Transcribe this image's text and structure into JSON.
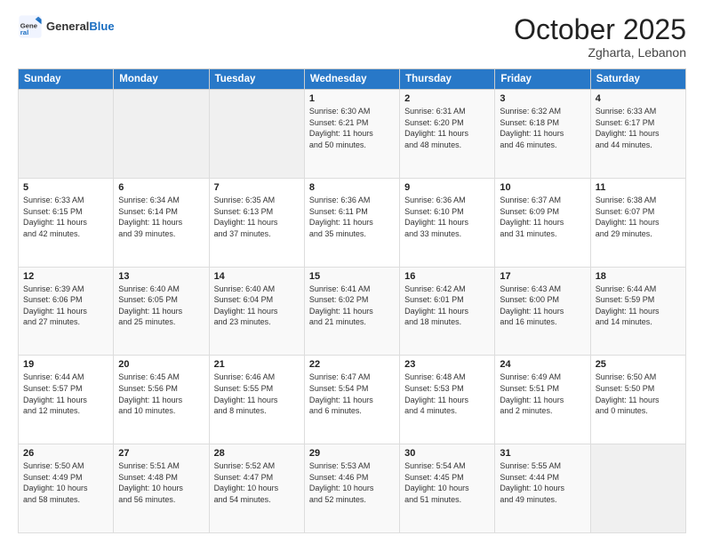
{
  "header": {
    "logo_general": "General",
    "logo_blue": "Blue",
    "month": "October 2025",
    "location": "Zgharta, Lebanon"
  },
  "weekdays": [
    "Sunday",
    "Monday",
    "Tuesday",
    "Wednesday",
    "Thursday",
    "Friday",
    "Saturday"
  ],
  "weeks": [
    [
      {
        "day": "",
        "info": ""
      },
      {
        "day": "",
        "info": ""
      },
      {
        "day": "",
        "info": ""
      },
      {
        "day": "1",
        "info": "Sunrise: 6:30 AM\nSunset: 6:21 PM\nDaylight: 11 hours\nand 50 minutes."
      },
      {
        "day": "2",
        "info": "Sunrise: 6:31 AM\nSunset: 6:20 PM\nDaylight: 11 hours\nand 48 minutes."
      },
      {
        "day": "3",
        "info": "Sunrise: 6:32 AM\nSunset: 6:18 PM\nDaylight: 11 hours\nand 46 minutes."
      },
      {
        "day": "4",
        "info": "Sunrise: 6:33 AM\nSunset: 6:17 PM\nDaylight: 11 hours\nand 44 minutes."
      }
    ],
    [
      {
        "day": "5",
        "info": "Sunrise: 6:33 AM\nSunset: 6:15 PM\nDaylight: 11 hours\nand 42 minutes."
      },
      {
        "day": "6",
        "info": "Sunrise: 6:34 AM\nSunset: 6:14 PM\nDaylight: 11 hours\nand 39 minutes."
      },
      {
        "day": "7",
        "info": "Sunrise: 6:35 AM\nSunset: 6:13 PM\nDaylight: 11 hours\nand 37 minutes."
      },
      {
        "day": "8",
        "info": "Sunrise: 6:36 AM\nSunset: 6:11 PM\nDaylight: 11 hours\nand 35 minutes."
      },
      {
        "day": "9",
        "info": "Sunrise: 6:36 AM\nSunset: 6:10 PM\nDaylight: 11 hours\nand 33 minutes."
      },
      {
        "day": "10",
        "info": "Sunrise: 6:37 AM\nSunset: 6:09 PM\nDaylight: 11 hours\nand 31 minutes."
      },
      {
        "day": "11",
        "info": "Sunrise: 6:38 AM\nSunset: 6:07 PM\nDaylight: 11 hours\nand 29 minutes."
      }
    ],
    [
      {
        "day": "12",
        "info": "Sunrise: 6:39 AM\nSunset: 6:06 PM\nDaylight: 11 hours\nand 27 minutes."
      },
      {
        "day": "13",
        "info": "Sunrise: 6:40 AM\nSunset: 6:05 PM\nDaylight: 11 hours\nand 25 minutes."
      },
      {
        "day": "14",
        "info": "Sunrise: 6:40 AM\nSunset: 6:04 PM\nDaylight: 11 hours\nand 23 minutes."
      },
      {
        "day": "15",
        "info": "Sunrise: 6:41 AM\nSunset: 6:02 PM\nDaylight: 11 hours\nand 21 minutes."
      },
      {
        "day": "16",
        "info": "Sunrise: 6:42 AM\nSunset: 6:01 PM\nDaylight: 11 hours\nand 18 minutes."
      },
      {
        "day": "17",
        "info": "Sunrise: 6:43 AM\nSunset: 6:00 PM\nDaylight: 11 hours\nand 16 minutes."
      },
      {
        "day": "18",
        "info": "Sunrise: 6:44 AM\nSunset: 5:59 PM\nDaylight: 11 hours\nand 14 minutes."
      }
    ],
    [
      {
        "day": "19",
        "info": "Sunrise: 6:44 AM\nSunset: 5:57 PM\nDaylight: 11 hours\nand 12 minutes."
      },
      {
        "day": "20",
        "info": "Sunrise: 6:45 AM\nSunset: 5:56 PM\nDaylight: 11 hours\nand 10 minutes."
      },
      {
        "day": "21",
        "info": "Sunrise: 6:46 AM\nSunset: 5:55 PM\nDaylight: 11 hours\nand 8 minutes."
      },
      {
        "day": "22",
        "info": "Sunrise: 6:47 AM\nSunset: 5:54 PM\nDaylight: 11 hours\nand 6 minutes."
      },
      {
        "day": "23",
        "info": "Sunrise: 6:48 AM\nSunset: 5:53 PM\nDaylight: 11 hours\nand 4 minutes."
      },
      {
        "day": "24",
        "info": "Sunrise: 6:49 AM\nSunset: 5:51 PM\nDaylight: 11 hours\nand 2 minutes."
      },
      {
        "day": "25",
        "info": "Sunrise: 6:50 AM\nSunset: 5:50 PM\nDaylight: 11 hours\nand 0 minutes."
      }
    ],
    [
      {
        "day": "26",
        "info": "Sunrise: 5:50 AM\nSunset: 4:49 PM\nDaylight: 10 hours\nand 58 minutes."
      },
      {
        "day": "27",
        "info": "Sunrise: 5:51 AM\nSunset: 4:48 PM\nDaylight: 10 hours\nand 56 minutes."
      },
      {
        "day": "28",
        "info": "Sunrise: 5:52 AM\nSunset: 4:47 PM\nDaylight: 10 hours\nand 54 minutes."
      },
      {
        "day": "29",
        "info": "Sunrise: 5:53 AM\nSunset: 4:46 PM\nDaylight: 10 hours\nand 52 minutes."
      },
      {
        "day": "30",
        "info": "Sunrise: 5:54 AM\nSunset: 4:45 PM\nDaylight: 10 hours\nand 51 minutes."
      },
      {
        "day": "31",
        "info": "Sunrise: 5:55 AM\nSunset: 4:44 PM\nDaylight: 10 hours\nand 49 minutes."
      },
      {
        "day": "",
        "info": ""
      }
    ]
  ]
}
